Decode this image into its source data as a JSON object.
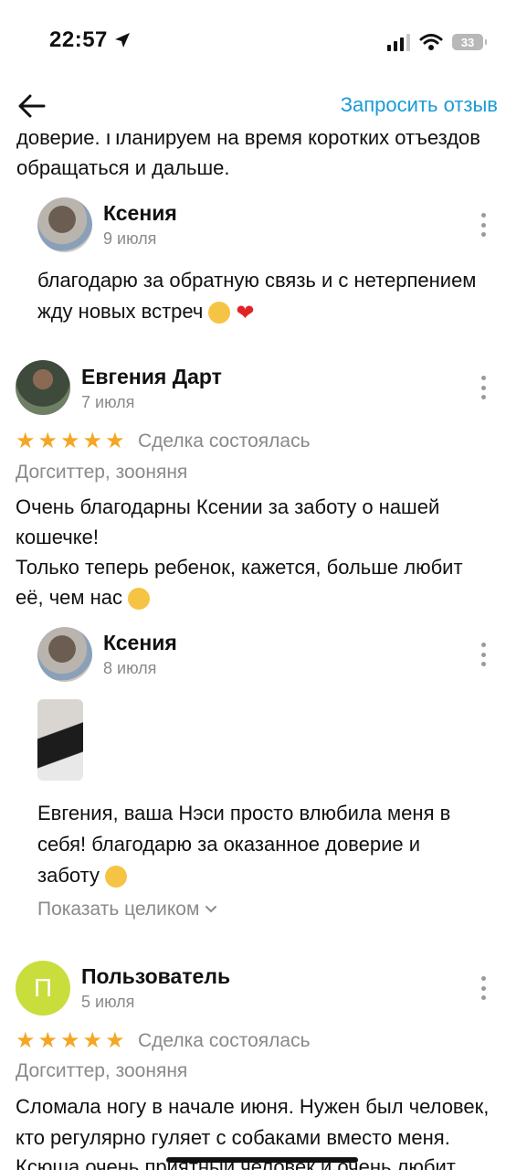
{
  "status_bar": {
    "time": "22:57",
    "battery": "33"
  },
  "header": {
    "request_review": "Запросить отзыв"
  },
  "top_fragment": {
    "line1": "доверие. Планируем на время коротких отъездов",
    "line2": "обращаться и дальше."
  },
  "reply1": {
    "name": "Ксения",
    "date": "9 июля",
    "line1": "благодарю за обратную связь и с нетерпением",
    "line2": "жду новых встреч"
  },
  "review1": {
    "name": "Евгения Дарт",
    "date": "7 июля",
    "deal": "Сделка состоялась",
    "category": "Догситтер, зооняня",
    "line1": "Очень благодарны Ксении за заботу о нашей",
    "line2": "кошечке!",
    "line3": "Только теперь ребенок, кажется, больше любит",
    "line4": "её, чем нас"
  },
  "reply2": {
    "name": "Ксения",
    "date": "8 июля",
    "line1": "Евгения, ваша Нэси просто влюбила меня в",
    "line2": "себя! благодарю за оказанное доверие и",
    "line3": "заботу",
    "show_all": "Показать целиком"
  },
  "review2": {
    "avatar_letter": "П",
    "name": "Пользователь",
    "date": "5 июля",
    "deal": "Сделка состоялась",
    "category": "Догситтер, зооняня",
    "line1": "Сломала ногу в начале июня. Нужен был человек,",
    "line2": "кто регулярно гуляет с собаками вместо меня.",
    "line3": "Ксюша очень приятный человек и очень любит"
  },
  "colors": {
    "accent": "#1a9bd7",
    "star": "#f5a623",
    "secondary_text": "#8a8a8a",
    "user_avatar": "#c9dd3c"
  },
  "icons": [
    "location-arrow-icon",
    "signal-icon",
    "wifi-icon",
    "battery-icon",
    "back-arrow-icon",
    "more-icon",
    "star-icon",
    "chevron-down-icon"
  ]
}
